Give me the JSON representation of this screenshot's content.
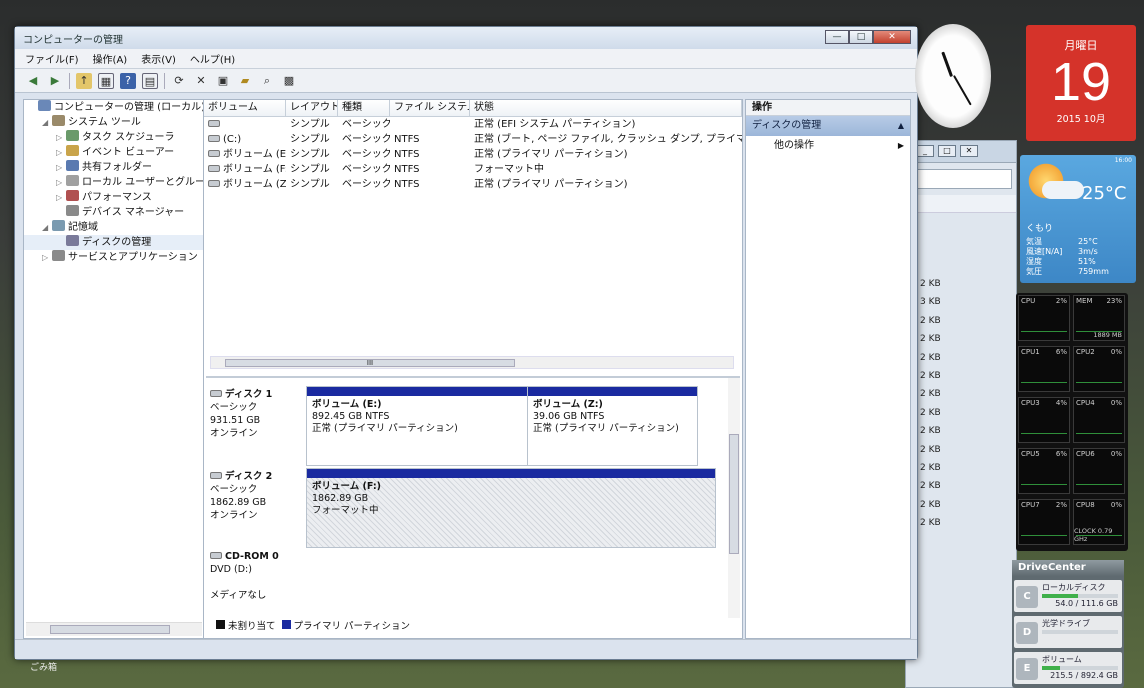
{
  "window": {
    "title": "コンピューターの管理",
    "controls": [
      "—",
      "□",
      "✕"
    ]
  },
  "menu": [
    "ファイル(F)",
    "操作(A)",
    "表示(V)",
    "ヘルプ(H)"
  ],
  "toolbar_icons": [
    "back-icon",
    "forward-icon",
    "up-folder-icon",
    "console-tree-icon",
    "help-icon",
    "properties-icon",
    "refresh-icon",
    "delete-icon",
    "properties2-icon",
    "open-icon",
    "search-icon",
    "options-icon"
  ],
  "tree": [
    {
      "label": "コンピューターの管理 (ローカル)",
      "level": 0,
      "arrow": ""
    },
    {
      "label": "システム ツール",
      "level": 1,
      "arrow": "◢"
    },
    {
      "label": "タスク スケジューラ",
      "level": 2,
      "arrow": "▷"
    },
    {
      "label": "イベント ビューアー",
      "level": 2,
      "arrow": "▷"
    },
    {
      "label": "共有フォルダー",
      "level": 2,
      "arrow": "▷"
    },
    {
      "label": "ローカル ユーザーとグループ",
      "level": 2,
      "arrow": "▷"
    },
    {
      "label": "パフォーマンス",
      "level": 2,
      "arrow": "▷"
    },
    {
      "label": "デバイス マネージャー",
      "level": 2,
      "arrow": ""
    },
    {
      "label": "記憶域",
      "level": 1,
      "arrow": "◢"
    },
    {
      "label": "ディスクの管理",
      "level": 2,
      "arrow": ""
    },
    {
      "label": "サービスとアプリケーション",
      "level": 1,
      "arrow": "▷"
    }
  ],
  "volume_table": {
    "headers": [
      "ボリューム",
      "レイアウト",
      "種類",
      "ファイル システム",
      "状態"
    ],
    "rows": [
      [
        "",
        "シンプル",
        "ベーシック",
        "",
        "正常 (EFI システム パーティション)"
      ],
      [
        "(C:)",
        "シンプル",
        "ベーシック",
        "NTFS",
        "正常 (ブート, ページ ファイル, クラッシュ ダンプ, プライマリ パーティ"
      ],
      [
        "ボリューム (E:)",
        "シンプル",
        "ベーシック",
        "NTFS",
        "正常 (プライマリ パーティション)"
      ],
      [
        "ボリューム (F:)",
        "シンプル",
        "ベーシック",
        "NTFS",
        "フォーマット中"
      ],
      [
        "ボリューム (Z:)",
        "シンプル",
        "ベーシック",
        "NTFS",
        "正常 (プライマリ パーティション)"
      ]
    ],
    "scroll_grip": "III"
  },
  "disks": [
    {
      "name": "ディスク 1",
      "type": "ベーシック",
      "size": "931.51 GB",
      "status": "オンライン",
      "partitions": [
        {
          "name": "ボリューム (E:)",
          "size": "892.45 GB NTFS",
          "status": "正常 (プライマリ パーティション)"
        },
        {
          "name": "ボリューム (Z:)",
          "size": "39.06 GB NTFS",
          "status": "正常 (プライマリ パーティション)"
        }
      ]
    },
    {
      "name": "ディスク 2",
      "type": "ベーシック",
      "size": "1862.89 GB",
      "status": "オンライン",
      "partitions": [
        {
          "name": "ボリューム (F:)",
          "size": "1862.89 GB",
          "status": "フォーマット中"
        }
      ]
    },
    {
      "name": "CD-ROM 0",
      "type": "DVD (D:)",
      "size": "",
      "status": "メディアなし"
    }
  ],
  "legend": [
    {
      "label": "未割り当て",
      "color": "#111111"
    },
    {
      "label": "プライマリ パーティション",
      "color": "#1a2aa0"
    }
  ],
  "actions": {
    "header": "操作",
    "section": "ディスクの管理",
    "items": [
      "他の操作"
    ]
  },
  "background_window": {
    "sizes": [
      "2 KB",
      "3 KB",
      "2 KB",
      "2 KB",
      "2 KB",
      "2 KB",
      "2 KB",
      "2 KB",
      "2 KB",
      "2 KB",
      "2 KB",
      "2 KB",
      "2 KB",
      "2 KB"
    ]
  },
  "calendar": {
    "weekday": "月曜日",
    "day": "19",
    "year_month": "2015 10月"
  },
  "weather": {
    "temp": "25°C",
    "condition": "くもり",
    "time": "16:00",
    "rows": [
      {
        "k": "気温",
        "v": "25°C"
      },
      {
        "k": "風速[N/A]",
        "v": "3m/s"
      },
      {
        "k": "湿度",
        "v": "51%"
      },
      {
        "k": "気圧",
        "v": "759mm"
      }
    ]
  },
  "cpu_meter": {
    "cells": [
      {
        "l": "CPU",
        "r": "2%"
      },
      {
        "l": "MEM",
        "r": "23%",
        "extra": "1889 MB"
      },
      {
        "l": "CPU1",
        "r": "6%"
      },
      {
        "l": "CPU2",
        "r": "0%"
      },
      {
        "l": "CPU3",
        "r": "4%"
      },
      {
        "l": "CPU4",
        "r": "0%"
      },
      {
        "l": "CPU5",
        "r": "6%"
      },
      {
        "l": "CPU6",
        "r": "0%"
      },
      {
        "l": "CPU7",
        "r": "2%"
      },
      {
        "l": "CPU8",
        "r": "0%",
        "extra": "CLOCK 0.79 GHz"
      }
    ]
  },
  "drive_center": {
    "title": "DriveCenter",
    "items": [
      {
        "letter": "C",
        "name": "ローカルディスク",
        "size": "54.0 / 111.6 GB",
        "used": 0.48
      },
      {
        "letter": "D",
        "name": "光学ドライブ",
        "size": "",
        "used": 0
      },
      {
        "letter": "E",
        "name": "ボリューム",
        "size": "215.5 / 892.4 GB",
        "used": 0.24
      }
    ]
  },
  "recycle_bin": "ごみ箱"
}
